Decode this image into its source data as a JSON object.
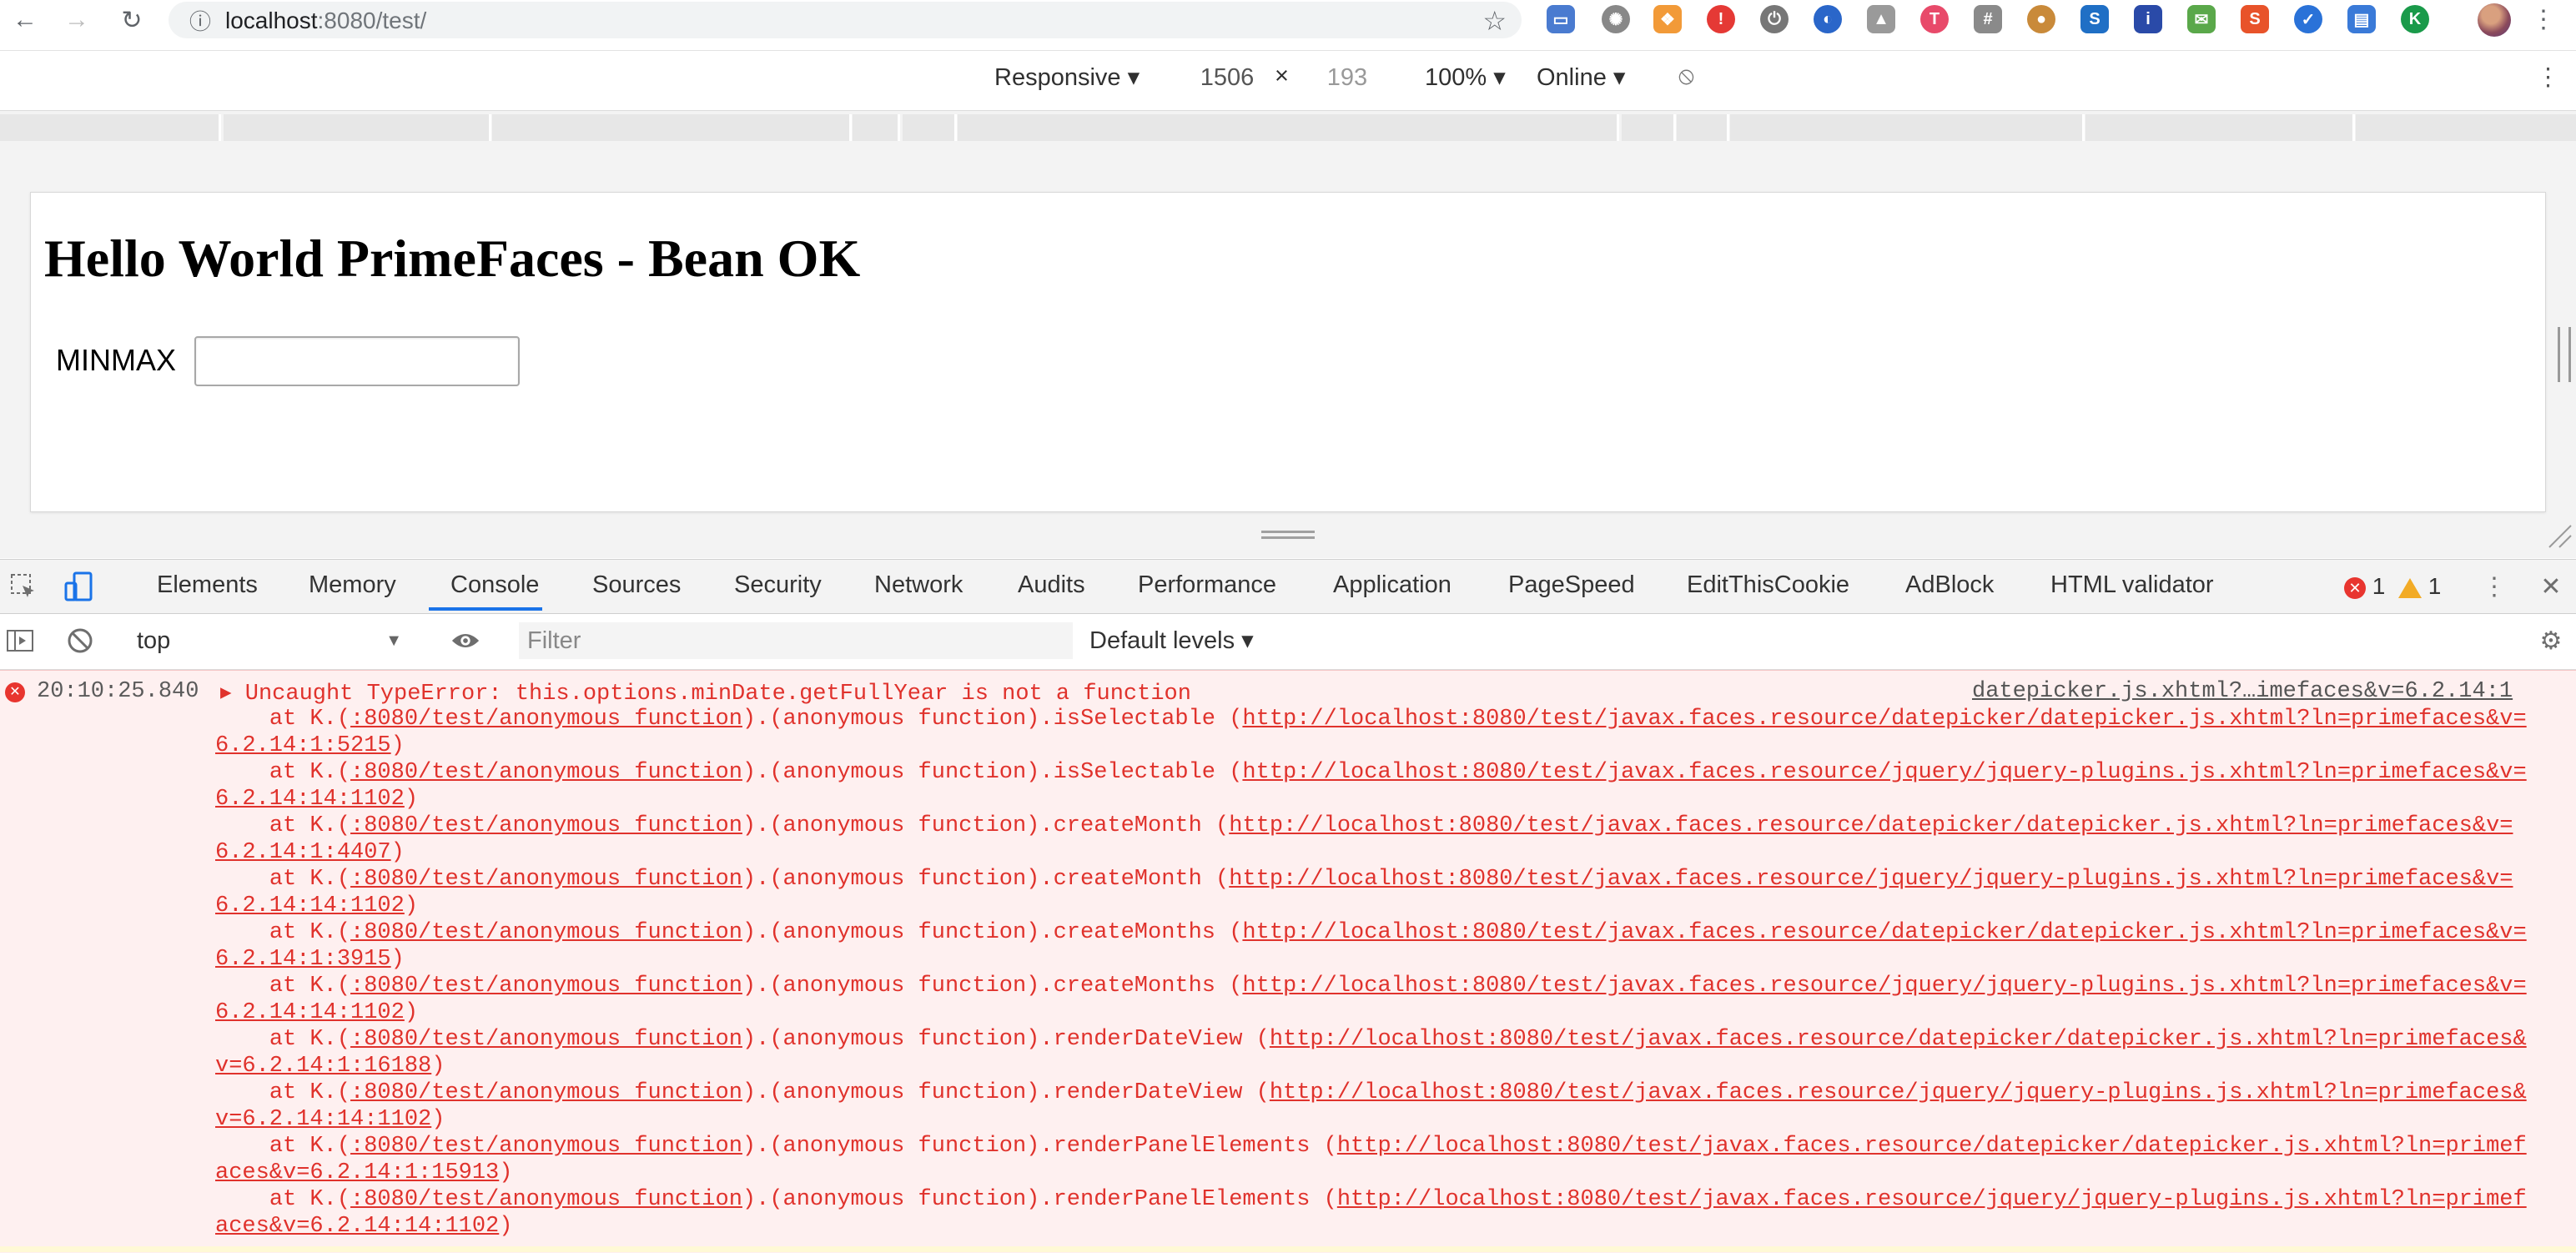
{
  "browser": {
    "url_host": "localhost",
    "url_rest": ":8080/test/"
  },
  "device_toolbar": {
    "device": "Responsive",
    "width": "1506",
    "times": "×",
    "height": "193",
    "zoom": "100%",
    "network": "Online"
  },
  "page": {
    "heading": "Hello World PrimeFaces - Bean OK",
    "field_label": "MINMAX",
    "field_value": ""
  },
  "devtools": {
    "tabs": [
      "Elements",
      "Memory",
      "Console",
      "Sources",
      "Security",
      "Network",
      "Audits",
      "Performance",
      "Application",
      "PageSpeed",
      "EditThisCookie",
      "AdBlock",
      "HTML validator"
    ],
    "active_tab": "Console",
    "error_count": "1",
    "warning_count": "1",
    "context": "top",
    "filter_placeholder": "Filter",
    "levels": "Default levels"
  },
  "console": {
    "timestamp": "20:10:25.840",
    "message": "Uncaught TypeError: this.options.minDate.getFullYear is not a function",
    "source": "datepicker.js.xhtml?…imefaces&v=6.2.14:1",
    "stack": [
      {
        "pre": "    at K.(",
        "loc": ":8080/test/anonymous function",
        "fn": ").(anonymous function).isSelectable (",
        "url": "http://localhost:8080/test/javax.faces.resource/datepicker/datepicker.js.xhtml?ln=primefaces&v=6.2.14:1:5215",
        "post": ")"
      },
      {
        "pre": "    at K.(",
        "loc": ":8080/test/anonymous function",
        "fn": ").(anonymous function).isSelectable (",
        "url": "http://localhost:8080/test/javax.faces.resource/jquery/jquery-plugins.js.xhtml?ln=primefaces&v=6.2.14:14:1102",
        "post": ")"
      },
      {
        "pre": "    at K.(",
        "loc": ":8080/test/anonymous function",
        "fn": ").(anonymous function).createMonth (",
        "url": "http://localhost:8080/test/javax.faces.resource/datepicker/datepicker.js.xhtml?ln=primefaces&v=6.2.14:1:4407",
        "post": ")"
      },
      {
        "pre": "    at K.(",
        "loc": ":8080/test/anonymous function",
        "fn": ").(anonymous function).createMonth (",
        "url": "http://localhost:8080/test/javax.faces.resource/jquery/jquery-plugins.js.xhtml?ln=primefaces&v=6.2.14:14:1102",
        "post": ")"
      },
      {
        "pre": "    at K.(",
        "loc": ":8080/test/anonymous function",
        "fn": ").(anonymous function).createMonths (",
        "url": "http://localhost:8080/test/javax.faces.resource/datepicker/datepicker.js.xhtml?ln=primefaces&v=6.2.14:1:3915",
        "post": ")"
      },
      {
        "pre": "    at K.(",
        "loc": ":8080/test/anonymous function",
        "fn": ").(anonymous function).createMonths (",
        "url": "http://localhost:8080/test/javax.faces.resource/jquery/jquery-plugins.js.xhtml?ln=primefaces&v=6.2.14:14:1102",
        "post": ")"
      },
      {
        "pre": "    at K.(",
        "loc": ":8080/test/anonymous function",
        "fn": ").(anonymous function).renderDateView (",
        "url": "http://localhost:8080/test/javax.faces.resource/datepicker/datepicker.js.xhtml?ln=primefaces&v=6.2.14:1:16188",
        "post": ")"
      },
      {
        "pre": "    at K.(",
        "loc": ":8080/test/anonymous function",
        "fn": ").(anonymous function).renderDateView (",
        "url": "http://localhost:8080/test/javax.faces.resource/jquery/jquery-plugins.js.xhtml?ln=primefaces&v=6.2.14:14:1102",
        "post": ")"
      },
      {
        "pre": "    at K.(",
        "loc": ":8080/test/anonymous function",
        "fn": ").(anonymous function).renderPanelElements (",
        "url": "http://localhost:8080/test/javax.faces.resource/datepicker/datepicker.js.xhtml?ln=primefaces&v=6.2.14:1:15913",
        "post": ")"
      },
      {
        "pre": "    at K.(",
        "loc": ":8080/test/anonymous function",
        "fn": ").(anonymous function).renderPanelElements (",
        "url": "http://localhost:8080/test/javax.faces.resource/jquery/jquery-plugins.js.xhtml?ln=primefaces&v=6.2.14:14:1102",
        "post": ")"
      }
    ]
  },
  "colors": {
    "error_red": "#e0322c",
    "console_bg": "#fef0f0",
    "active_tab_underline": "#1a73e8"
  },
  "icons": [
    "back-icon",
    "forward-icon",
    "reload-icon",
    "info-icon",
    "star-icon",
    "menu-kebab-icon",
    "rotate-icon",
    "inspect-icon",
    "device-icon",
    "close-icon",
    "sidebar-icon",
    "clear-icon",
    "eye-icon",
    "gear-icon"
  ]
}
